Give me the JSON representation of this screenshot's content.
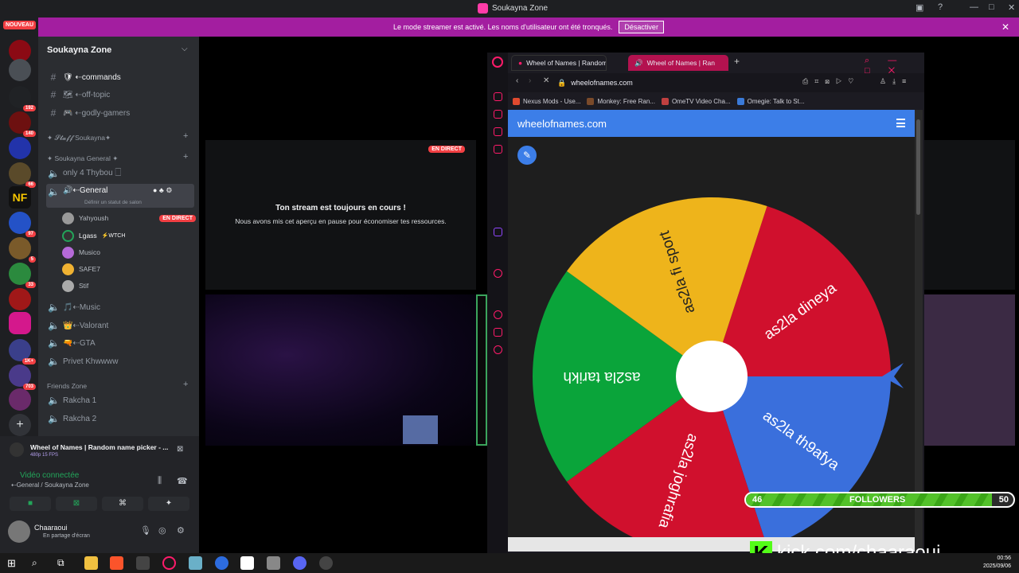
{
  "window": {
    "title": "Soukayna Zone"
  },
  "banner": {
    "text": "Le mode streamer est activé. Les noms d'utilisateur ont été tronqués.",
    "button": "Désactiver"
  },
  "rail": {
    "nouveau": "NOUVEAU",
    "badges": [
      "192",
      "140",
      "66",
      "97",
      "5",
      "33",
      "1K+",
      "703"
    ]
  },
  "guild": {
    "name": "Soukayna Zone",
    "channels": [
      {
        "name": "🛡 ⇠commands"
      },
      {
        "name": "🗺 ⇠off-topic"
      },
      {
        "name": "🎮 ⇠godly-gamers"
      }
    ],
    "category_staff": "✦ 𝓢𝓽𝓪𝓯𝓯 Soukayna✦",
    "category_general": "✦ Soukayna General ✦",
    "voice_top": "only 4 Thybou 🗌",
    "voice_general": "🔊⇠General",
    "voice_status": "Définir un statut de salon",
    "voice_users": [
      {
        "name": "Yahyoush",
        "live": "EN DIRECT"
      },
      {
        "name": "Lgass",
        "tag": "⚡WTCH"
      },
      {
        "name": "Musico"
      },
      {
        "name": "SAFE7"
      },
      {
        "name": "Stif"
      }
    ],
    "voice_more": [
      "🎵⇠Music",
      "👑⇠Valorant",
      "🔫⇠GTA",
      "Privet Khwwww"
    ],
    "category_friends": "Friends Zone",
    "friends": [
      "Rakcha 1",
      "Rakcha 2"
    ]
  },
  "voicepanel": {
    "activity": "Wheel of Names | Random name picker - ...",
    "quality": "480p 15 FPS",
    "connected": "Vidéo connectée",
    "location": "⇠General / Soukayna Zone",
    "user": "Chaaraoui",
    "user_status": "En partage d'écran"
  },
  "stage": {
    "live_badge": "EN DIRECT",
    "pause_title": "Ton stream est toujours en cours !",
    "pause_sub": "Nous avons mis cet aperçu en pause pour économiser tes ressources."
  },
  "browser": {
    "tabs": [
      "Wheel of Names | Random",
      "Wheel of Names | Ran"
    ],
    "url": "wheelofnames.com",
    "bookmarks": [
      "Nexus Mods - Use...",
      "Monkey: Free Ran...",
      "OmeTV Video Cha...",
      "Omegie: Talk to St..."
    ]
  },
  "wheel": {
    "site": "wheelofnames.com",
    "segments": [
      {
        "label": "as2la dineya",
        "color": "#d0102d"
      },
      {
        "label": "as2la th9afya",
        "color": "#3a6fdc"
      },
      {
        "label": "as2la joghrafia",
        "color": "#d0102d"
      },
      {
        "label": "as2la tarikh",
        "color": "#0aa43a"
      },
      {
        "label": "as2la fi sport",
        "color": "#eeb41b"
      }
    ]
  },
  "overlay": {
    "followers_label": "FOLLOWERS",
    "current": "46",
    "goal": "50",
    "progress": 0.92,
    "kick": "kick.com/chaaraoui"
  },
  "taskbar": {
    "time": "00:56",
    "date": "2025/09/06"
  }
}
